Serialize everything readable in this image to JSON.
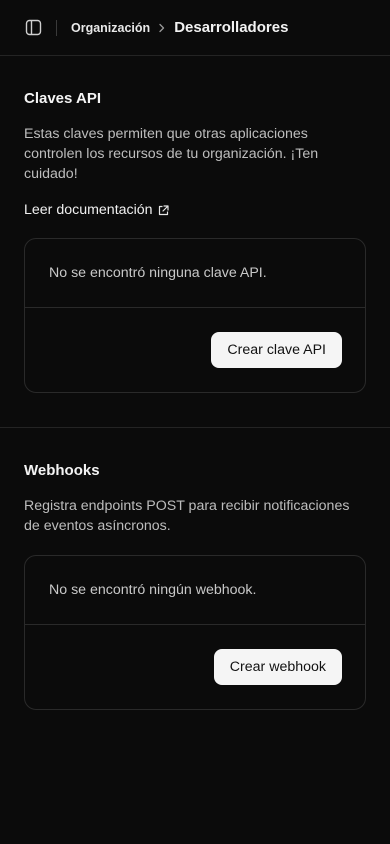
{
  "header": {
    "breadcrumb_org": "Organización",
    "breadcrumb_page": "Desarrolladores"
  },
  "api_keys": {
    "title": "Claves API",
    "description": "Estas claves permiten que otras aplicaciones controlen los recursos de tu organización. ¡Ten cuidado!",
    "doc_link": "Leer documentación",
    "empty_text": "No se encontró ninguna clave API.",
    "create_label": "Crear clave API"
  },
  "webhooks": {
    "title": "Webhooks",
    "description": "Registra endpoints POST para recibir notificaciones de eventos asíncronos.",
    "empty_text": "No se encontró ningún webhook.",
    "create_label": "Crear webhook"
  },
  "icons": {
    "sidebar_toggle": "sidebar-panel-icon",
    "breadcrumb_separator": "chevron-right-icon",
    "doc_link": "external-link-icon"
  },
  "colors": {
    "background": "#0b0b0b",
    "border": "#2a2a2a",
    "button_bg": "#f5f5f5",
    "text_primary": "#ededed",
    "text_muted": "#bdbdbd"
  }
}
